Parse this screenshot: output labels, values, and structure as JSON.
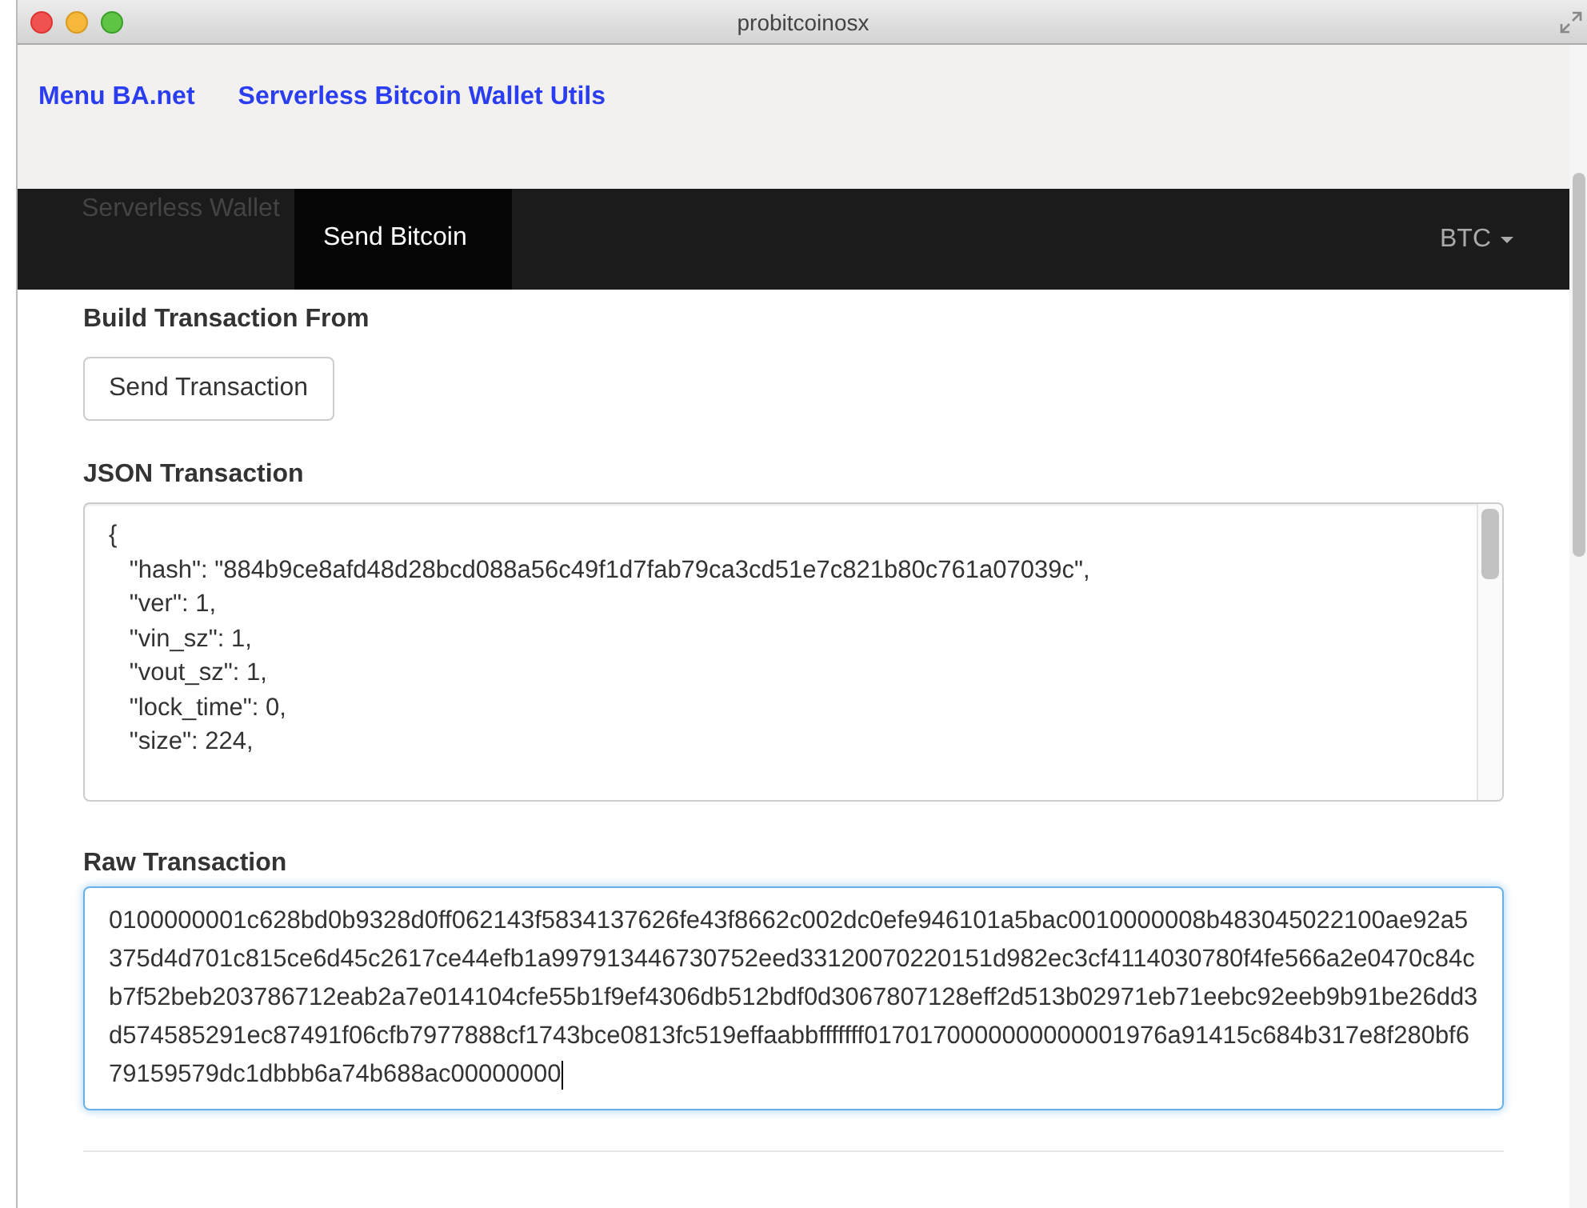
{
  "window": {
    "title": "probitcoinosx"
  },
  "header_links": [
    "Menu BA.net",
    "Serverless Bitcoin Wallet Utils"
  ],
  "navbar": {
    "tabs": [
      {
        "label": "Serverless Wallet",
        "selected": false
      },
      {
        "label": "Send Bitcoin",
        "selected": true
      }
    ],
    "dropdown": "BTC"
  },
  "build_section": {
    "heading": "Build Transaction From",
    "button": "Send Transaction"
  },
  "json_section": {
    "heading": "JSON Transaction",
    "value": "{\n   \"hash\": \"884b9ce8afd48d28bcd088a56c49f1d7fab79ca3cd51e7c821b80c761a07039c\",\n   \"ver\": 1,\n   \"vin_sz\": 1,\n   \"vout_sz\": 1,\n   \"lock_time\": 0,\n   \"size\": 224,"
  },
  "raw_section": {
    "heading": "Raw Transaction",
    "value": "0100000001c628bd0b9328d0ff062143f5834137626fe43f8662c002dc0efe946101a5bac0010000008b483045022100ae92a5375d4d701c815ce6d45c2617ce44efb1a997913446730752eed33120070220151d982ec3cf4114030780f4fe566a2e0470c84cb7f52beb203786712eab2a7e014104cfe55b1f9ef4306db512bdf0d3067807128eff2d513b02971eb71eebc92eeb9b91be26dd3d574585291ec87491f06cfb7977888cf1743bce0813fc519effaabbfffffff0170170000000000001976a91415c684b317e8f280bf679159579dc1dbbb6a74b688ac00000000",
    "focused": true
  }
}
